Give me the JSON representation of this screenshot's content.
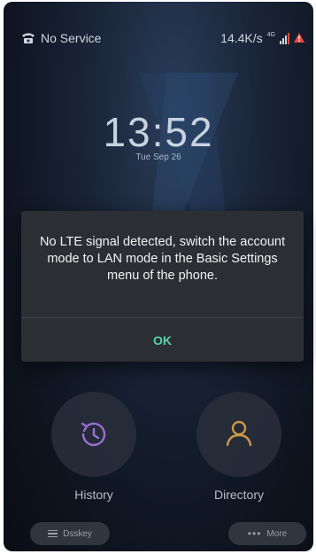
{
  "status_bar": {
    "service_text": "No Service",
    "network_speed": "14.4K/s",
    "network_type": "4G"
  },
  "lock_screen": {
    "time": "13:52",
    "date": "Tue Sep 26"
  },
  "dialog": {
    "message": "No LTE signal detected, switch the account mode to LAN mode in the Basic Settings menu of the phone.",
    "ok_label": "OK"
  },
  "actions": {
    "history_label": "History",
    "directory_label": "Directory"
  },
  "softkeys": {
    "dsskey_label": "Dsskey",
    "more_label": "More",
    "more_dots": "•••"
  },
  "colors": {
    "accent_ok": "#5ed3a6",
    "history_icon": "#9b6fd6",
    "directory_icon": "#c89a45",
    "alert": "#e04a3f"
  }
}
